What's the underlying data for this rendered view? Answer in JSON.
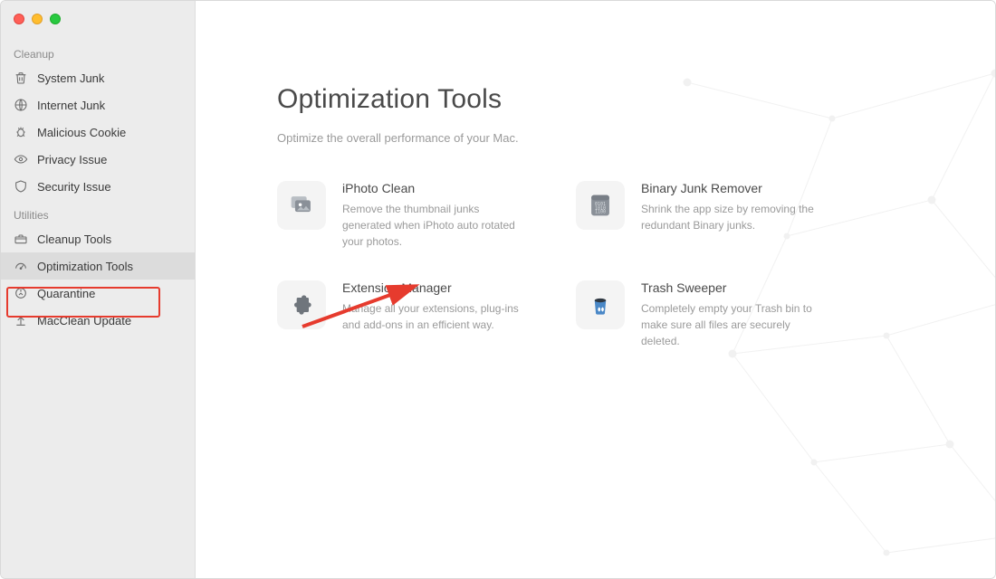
{
  "sidebar": {
    "sections": [
      {
        "title": "Cleanup",
        "items": [
          {
            "id": "system-junk",
            "label": "System Junk",
            "icon": "trash"
          },
          {
            "id": "internet-junk",
            "label": "Internet Junk",
            "icon": "globe"
          },
          {
            "id": "malicious-cookie",
            "label": "Malicious Cookie",
            "icon": "bug"
          },
          {
            "id": "privacy-issue",
            "label": "Privacy Issue",
            "icon": "eye"
          },
          {
            "id": "security-issue",
            "label": "Security Issue",
            "icon": "shield"
          }
        ]
      },
      {
        "title": "Utilities",
        "items": [
          {
            "id": "cleanup-tools",
            "label": "Cleanup Tools",
            "icon": "toolbox"
          },
          {
            "id": "optimization-tools",
            "label": "Optimization Tools",
            "icon": "gauge",
            "selected": true
          },
          {
            "id": "quarantine",
            "label": "Quarantine",
            "icon": "quarantine"
          },
          {
            "id": "macclean-update",
            "label": "MacClean Update",
            "icon": "upload"
          }
        ]
      }
    ]
  },
  "main": {
    "title": "Optimization Tools",
    "subtitle": "Optimize the overall performance of your Mac.",
    "tools": [
      {
        "id": "iphoto-clean",
        "title": "iPhoto Clean",
        "desc": "Remove the thumbnail junks generated when iPhoto auto rotated your photos.",
        "icon": "photos"
      },
      {
        "id": "binary-junk-remover",
        "title": "Binary Junk Remover",
        "desc": "Shrink the app size by removing the redundant Binary junks.",
        "icon": "binary"
      },
      {
        "id": "extension-manager",
        "title": "Extension Manager",
        "desc": "Manage all your extensions, plug-ins and add-ons in an efficient way.",
        "icon": "puzzle"
      },
      {
        "id": "trash-sweeper",
        "title": "Trash Sweeper",
        "desc": "Completely empty your Trash bin to make sure all files are securely deleted.",
        "icon": "bin"
      }
    ]
  },
  "annotations": {
    "highlight_target": "optimization-tools",
    "arrow_target": "extension-manager"
  }
}
